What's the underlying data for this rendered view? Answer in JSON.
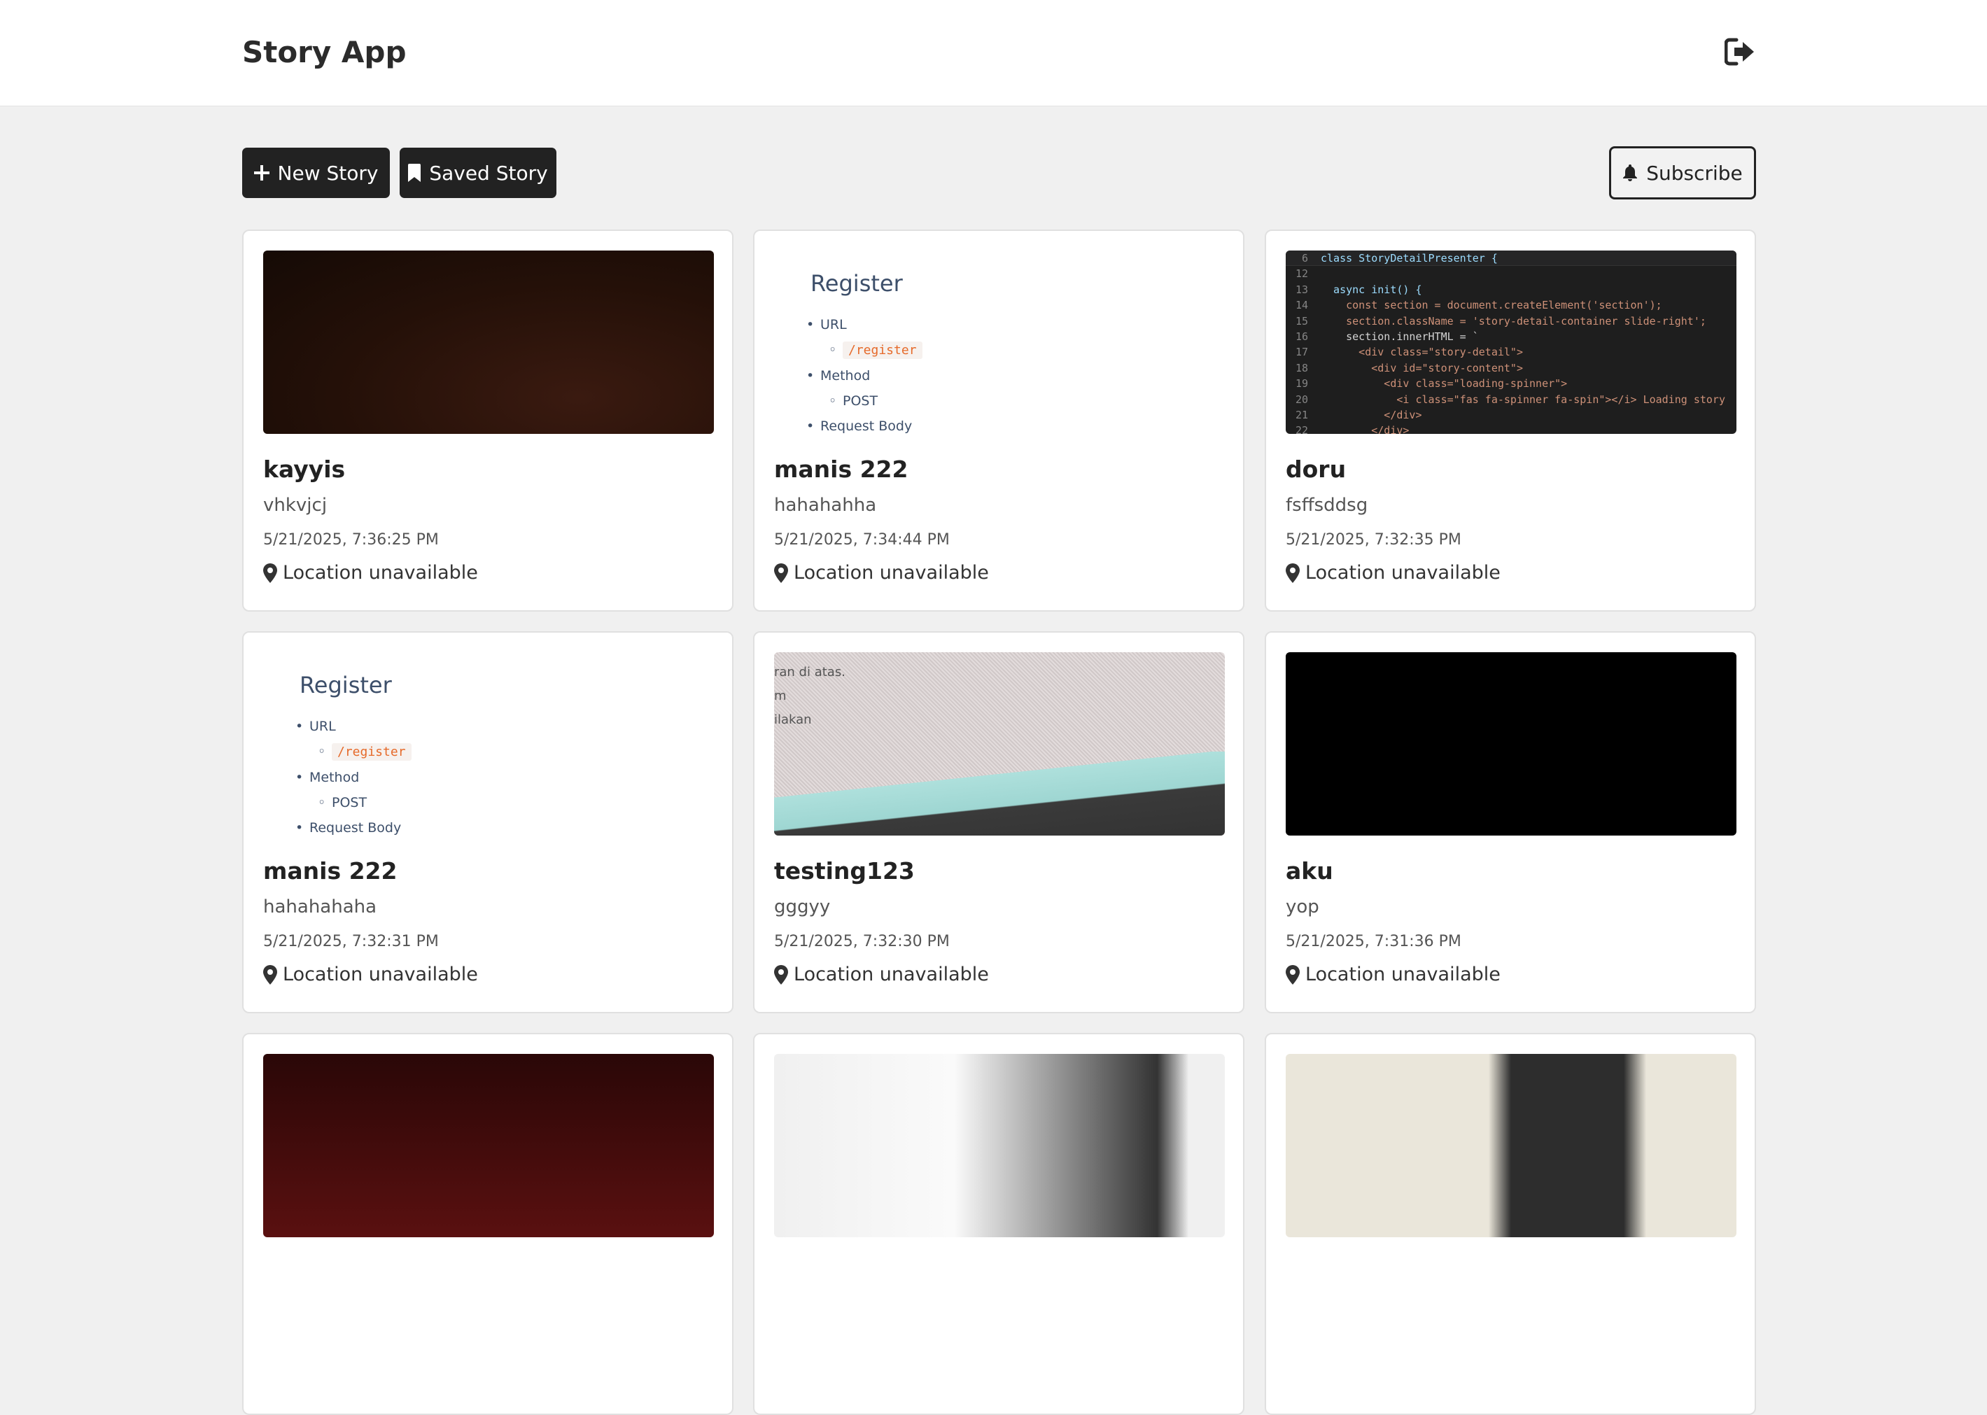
{
  "header": {
    "title": "Story App",
    "logout_icon": "sign-out-icon"
  },
  "toolbar": {
    "new_story_label": "New Story",
    "saved_story_label": "Saved Story",
    "subscribe_label": "Subscribe"
  },
  "stories": [
    {
      "name": "kayyis",
      "description": "vhkvjcj",
      "date": "5/21/2025, 7:36:25 PM",
      "location": "Location unavailable"
    },
    {
      "name": "manis 222",
      "description": "hahahahha",
      "date": "5/21/2025, 7:34:44 PM",
      "location": "Location unavailable",
      "image_text": {
        "heading": "Register",
        "item1": "URL",
        "item1_sub": "/register",
        "item2": "Method",
        "item2_sub": "POST",
        "item3": "Request Body"
      }
    },
    {
      "name": "doru",
      "description": "fsffsddsg",
      "date": "5/21/2025, 7:32:35 PM",
      "location": "Location unavailable",
      "code_lines": [
        {
          "n": "6",
          "t": "class StoryDetailPresenter {"
        },
        {
          "n": "12",
          "t": ""
        },
        {
          "n": "13",
          "t": "  async init() {"
        },
        {
          "n": "14",
          "t": "    const section = document.createElement('section');"
        },
        {
          "n": "15",
          "t": "    section.className = 'story-detail-container slide-right';"
        },
        {
          "n": "16",
          "t": "    section.innerHTML = `"
        },
        {
          "n": "17",
          "t": "      <div class=\"story-detail\">"
        },
        {
          "n": "18",
          "t": "        <div id=\"story-content\">"
        },
        {
          "n": "19",
          "t": "          <div class=\"loading-spinner\">"
        },
        {
          "n": "20",
          "t": "            <i class=\"fas fa-spinner fa-spin\"></i> Loading story"
        },
        {
          "n": "21",
          "t": "          </div>"
        },
        {
          "n": "22",
          "t": "        </div>"
        }
      ]
    },
    {
      "name": "manis 222",
      "description": "hahahahaha",
      "date": "5/21/2025, 7:32:31 PM",
      "location": "Location unavailable",
      "image_text": {
        "heading": "Register",
        "item1": "URL",
        "item1_sub": "/register",
        "item2": "Method",
        "item2_sub": "POST",
        "item3": "Request Body"
      }
    },
    {
      "name": "testing123",
      "description": "gggyy",
      "date": "5/21/2025, 7:32:30 PM",
      "location": "Location unavailable",
      "image_text": {
        "line1": "ran di atas.",
        "line2": "m",
        "line3": "ilakan"
      }
    },
    {
      "name": "aku",
      "description": "yop",
      "date": "5/21/2025, 7:31:36 PM",
      "location": "Location unavailable"
    }
  ],
  "icons": {
    "plus": "plus-icon",
    "bookmark": "bookmark-icon",
    "bell": "bell-icon",
    "location": "map-marker-icon"
  }
}
